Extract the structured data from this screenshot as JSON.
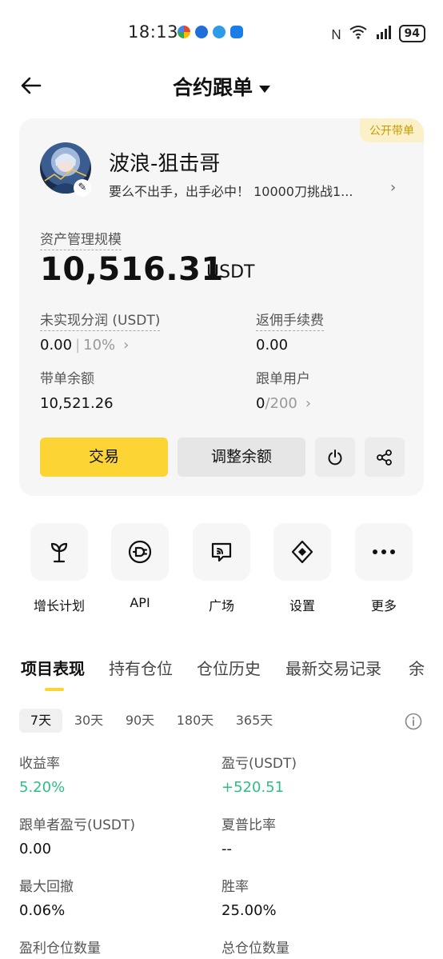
{
  "status": {
    "time": "18:13",
    "battery": "94"
  },
  "header": {
    "title": "合约跟单"
  },
  "card": {
    "badge": "公开带单",
    "trader_name": "波浪-狙击哥",
    "bio": "要么不出手，出手必中！ 10000刀挑战1...",
    "aum_label": "资产管理规模",
    "aum_value": "10,516.31",
    "aum_unit": "USDT",
    "unrealized_label": "未实现分润 (USDT)",
    "unrealized_value": "0.00",
    "unrealized_pct": "10%",
    "rebate_label": "返佣手续费",
    "rebate_value": "0.00",
    "balance_label": "带单余额",
    "balance_value": "10,521.26",
    "followers_label": "跟单用户",
    "followers_value": "0",
    "followers_max": "/200",
    "trade_button": "交易",
    "adjust_button": "调整余额"
  },
  "shortcuts": [
    {
      "label": "增长计划",
      "icon": "sprout-icon"
    },
    {
      "label": "API",
      "icon": "plug-icon"
    },
    {
      "label": "广场",
      "icon": "broadcast-chat-icon"
    },
    {
      "label": "设置",
      "icon": "settings-diamond-icon"
    },
    {
      "label": "更多",
      "icon": "more-dots-icon"
    }
  ],
  "tabs": [
    "项目表现",
    "持有仓位",
    "仓位历史",
    "最新交易记录",
    "余"
  ],
  "periods": [
    "7天",
    "30天",
    "90天",
    "180天",
    "365天"
  ],
  "metrics": {
    "roi_label": "收益率",
    "roi_value": "5.20%",
    "pnl_label": "盈亏(USDT)",
    "pnl_value": "+520.51",
    "follower_pnl_label": "跟单者盈亏(USDT)",
    "follower_pnl_value": "0.00",
    "sharpe_label": "夏普比率",
    "sharpe_value": "--",
    "drawdown_label": "最大回撤",
    "drawdown_value": "0.06%",
    "winrate_label": "胜率",
    "winrate_value": "25.00%",
    "profit_positions_label": "盈利仓位数量",
    "total_positions_label": "总仓位数量"
  },
  "colors": {
    "accent_yellow": "#fcd535",
    "positive_green": "#2ebd85",
    "badge_text": "#c99a00"
  }
}
